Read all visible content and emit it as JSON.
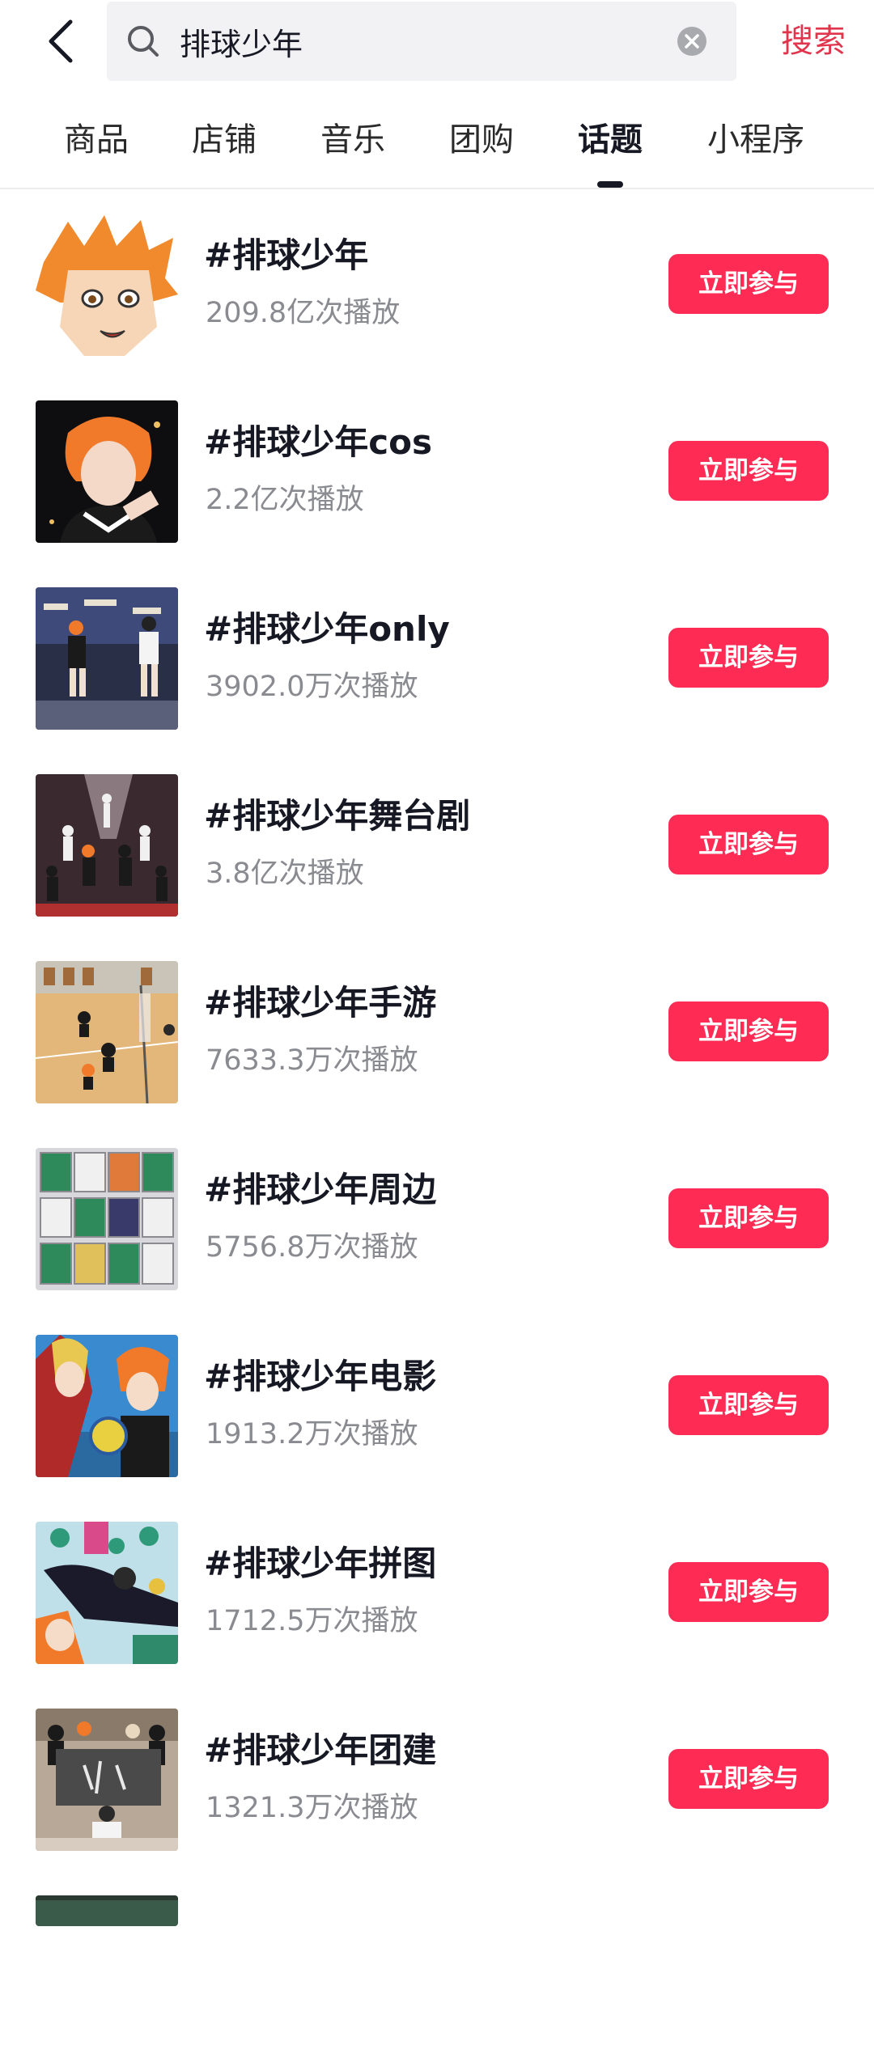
{
  "search": {
    "query": "排球少年",
    "submit_label": "搜索"
  },
  "tabs": [
    {
      "label": "商品"
    },
    {
      "label": "店铺"
    },
    {
      "label": "音乐"
    },
    {
      "label": "团购"
    },
    {
      "label": "话题",
      "active": true
    },
    {
      "label": "小程序"
    }
  ],
  "topics": [
    {
      "title": "#排球少年",
      "views": "209.8亿次播放",
      "action": "立即参与"
    },
    {
      "title": "#排球少年cos",
      "views": "2.2亿次播放",
      "action": "立即参与"
    },
    {
      "title": "#排球少年only",
      "views": "3902.0万次播放",
      "action": "立即参与"
    },
    {
      "title": "#排球少年舞台剧",
      "views": "3.8亿次播放",
      "action": "立即参与"
    },
    {
      "title": "#排球少年手游",
      "views": "7633.3万次播放",
      "action": "立即参与"
    },
    {
      "title": "#排球少年周边",
      "views": "5756.8万次播放",
      "action": "立即参与"
    },
    {
      "title": "#排球少年电影",
      "views": "1913.2万次播放",
      "action": "立即参与"
    },
    {
      "title": "#排球少年拼图",
      "views": "1712.5万次播放",
      "action": "立即参与"
    },
    {
      "title": "#排球少年团建",
      "views": "1321.3万次播放",
      "action": "立即参与"
    }
  ],
  "colors": {
    "accent": "#fe2c55",
    "search_submit": "#e0354c",
    "secondary_text": "#8a8b91"
  },
  "icons": {
    "back": "chevron-left-icon",
    "search": "search-icon",
    "clear": "clear-circle-icon"
  }
}
